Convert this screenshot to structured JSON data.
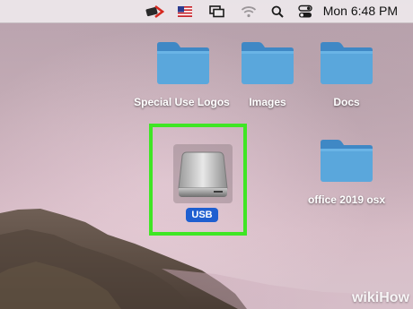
{
  "menubar": {
    "clock": "Mon 6:48 PM",
    "icons": [
      "usb-eject-icon",
      "flag-us-icon",
      "window-switcher-icon",
      "wifi-icon",
      "search-icon",
      "control-center-icon"
    ]
  },
  "desktop": {
    "items": [
      {
        "label": "Special Use Logos",
        "icon": "folder-icon"
      },
      {
        "label": "Images",
        "icon": "folder-icon"
      },
      {
        "label": "Docs",
        "icon": "folder-icon"
      },
      {
        "label": "USB",
        "icon": "external-drive-icon",
        "selected": true
      },
      {
        "label": "office 2019 osx",
        "icon": "folder-icon"
      }
    ]
  },
  "highlight_color": "#3fe624",
  "folder_color": "#5aa7dc",
  "watermark": "wikiHow"
}
